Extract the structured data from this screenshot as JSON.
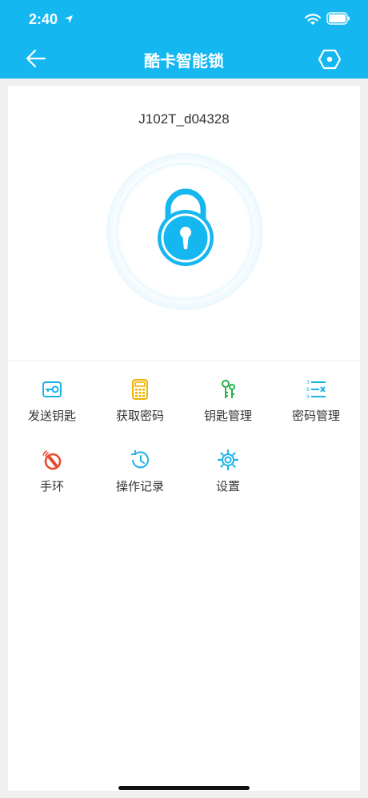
{
  "status": {
    "time": "2:40"
  },
  "nav": {
    "title": "酷卡智能锁"
  },
  "device": {
    "name": "J102T_d04328"
  },
  "grid": [
    {
      "label": "发送钥匙",
      "icon": "send-key-icon",
      "color": "#1cb3e8"
    },
    {
      "label": "获取密码",
      "icon": "calculator-icon",
      "color": "#f0b400"
    },
    {
      "label": "钥匙管理",
      "icon": "keys-icon",
      "color": "#27b24a"
    },
    {
      "label": "密码管理",
      "icon": "password-list-icon",
      "color": "#1cb3e8"
    },
    {
      "label": "手环",
      "icon": "bracelet-icon",
      "color": "#e84a2f"
    },
    {
      "label": "操作记录",
      "icon": "history-icon",
      "color": "#1cb3e8"
    },
    {
      "label": "设置",
      "icon": "gear-icon",
      "color": "#1cb3e8"
    }
  ],
  "colors": {
    "accent": "#14b7f0"
  }
}
